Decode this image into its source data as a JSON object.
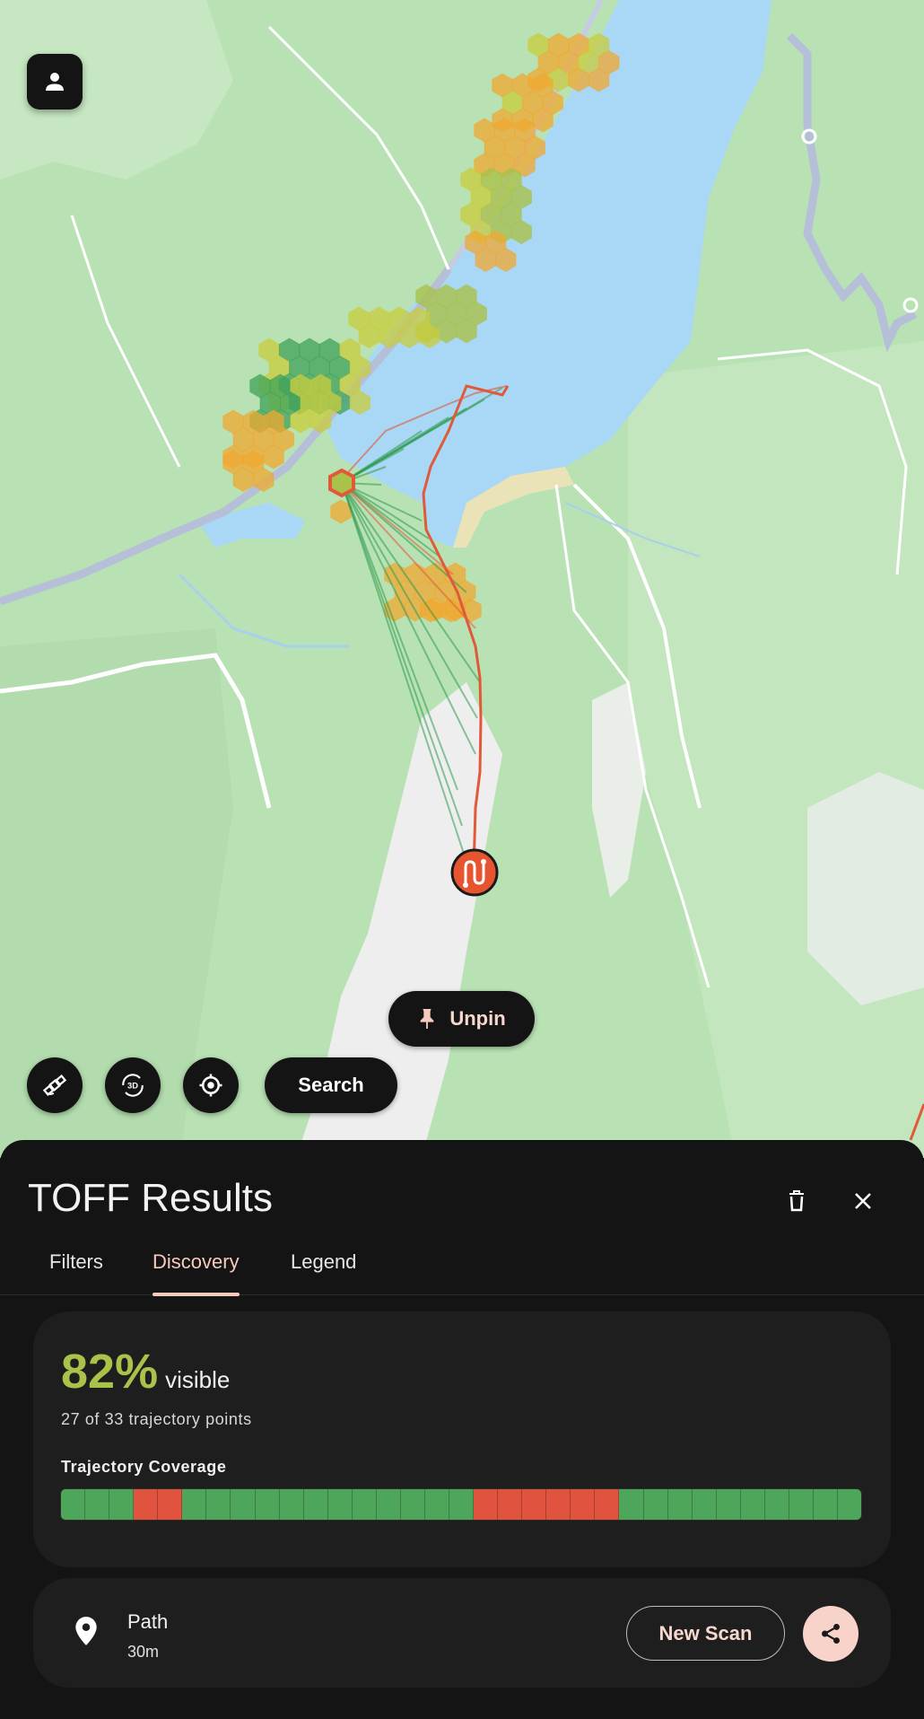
{
  "map": {
    "controls": {
      "profile_icon": "person-icon",
      "unpin_label": "Unpin",
      "search_label": "Search",
      "layers_icon": "satellite-icon",
      "view_3d_icon": "3d-rotate-icon",
      "locate_icon": "my-location-icon"
    },
    "colors": {
      "land": "#b7e0b3",
      "water": "#a8d8f5",
      "road": "#b6bed6",
      "mountain": "#ececec",
      "route": "#e05a3a",
      "ray": "#2f9a4f"
    }
  },
  "sheet": {
    "title": "TOFF Results",
    "tabs": [
      {
        "label": "Filters",
        "active": false
      },
      {
        "label": "Discovery",
        "active": true
      },
      {
        "label": "Legend",
        "active": false
      }
    ],
    "coverage": {
      "percent": "82%",
      "percent_label": "visible",
      "points_text": "27 of 33 trajectory points",
      "title": "Trajectory Coverage",
      "segments": [
        "v",
        "v",
        "v",
        "n",
        "n",
        "v",
        "v",
        "v",
        "v",
        "v",
        "v",
        "v",
        "v",
        "v",
        "v",
        "v",
        "v",
        "n",
        "n",
        "n",
        "n",
        "n",
        "n",
        "v",
        "v",
        "v",
        "v",
        "v",
        "v",
        "v",
        "v",
        "v",
        "v"
      ],
      "visible_color": "#4ea65b",
      "hidden_color": "#e0533f"
    },
    "path": {
      "label": "Path",
      "value": "30m",
      "new_scan_label": "New Scan"
    }
  }
}
